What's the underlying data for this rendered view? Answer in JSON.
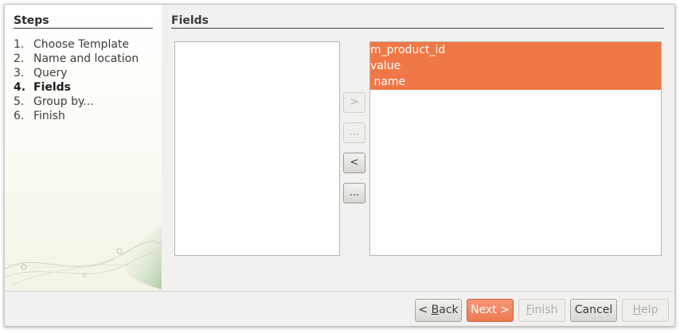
{
  "steps": {
    "title": "Steps",
    "items": [
      {
        "num": "1.",
        "label": "Choose Template",
        "active": false
      },
      {
        "num": "2.",
        "label": "Name and location",
        "active": false
      },
      {
        "num": "3.",
        "label": "Query",
        "active": false
      },
      {
        "num": "4.",
        "label": "Fields",
        "active": true
      },
      {
        "num": "5.",
        "label": "Group by...",
        "active": false
      },
      {
        "num": "6.",
        "label": "Finish",
        "active": false
      }
    ]
  },
  "fields": {
    "title": "Fields",
    "available": [],
    "selected": [
      "m_product_id",
      "value",
      " name"
    ]
  },
  "move_buttons": {
    "add_one": ">",
    "add_all": "...",
    "remove_one": "<",
    "remove_all": "..."
  },
  "footer": {
    "back": {
      "pre": "< ",
      "mnemonic": "B",
      "post": "ack"
    },
    "next": "Next >",
    "finish": {
      "mnemonic": "F",
      "post": "inish"
    },
    "cancel": "Cancel",
    "help": {
      "mnemonic": "H",
      "post": "elp"
    }
  },
  "colors": {
    "selection": "#f07746",
    "primary_button": "#ec7a52"
  }
}
